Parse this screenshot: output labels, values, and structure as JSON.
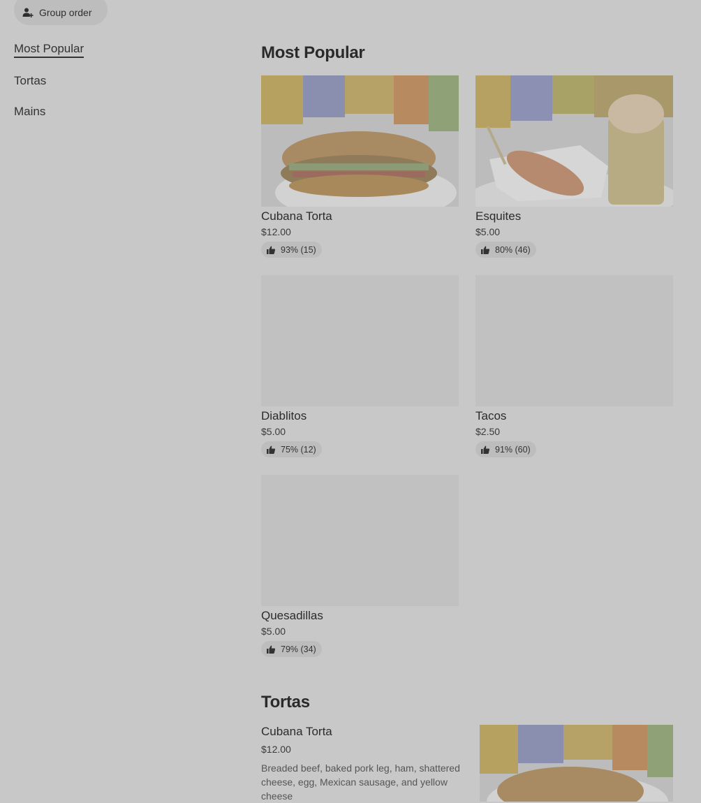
{
  "header": {
    "group_order_label": "Group order"
  },
  "sidebar": {
    "items": [
      {
        "label": "Most Popular",
        "active": true
      },
      {
        "label": "Tortas"
      },
      {
        "label": "Mains"
      }
    ]
  },
  "sections": {
    "most_popular": {
      "title": "Most Popular",
      "cards": [
        {
          "name": "Cubana Torta",
          "price": "$12.00",
          "rating": "93% (15)"
        },
        {
          "name": "Esquites",
          "price": "$5.00",
          "rating": "80% (46)"
        },
        {
          "name": "Diablitos",
          "price": "$5.00",
          "rating": "75% (12)"
        },
        {
          "name": "Tacos",
          "price": "$2.50",
          "rating": "91% (60)"
        },
        {
          "name": "Quesadillas",
          "price": "$5.00",
          "rating": "79% (34)"
        }
      ]
    },
    "tortas": {
      "title": "Tortas",
      "items": [
        {
          "name": "Cubana Torta",
          "price": "$12.00",
          "description": "Breaded beef, baked pork leg, ham, shattered cheese, egg, Mexican sausage, and yellow cheese"
        }
      ]
    }
  },
  "icons": {
    "group_order": "add-person-icon",
    "rating": "thumbs-up-icon"
  }
}
